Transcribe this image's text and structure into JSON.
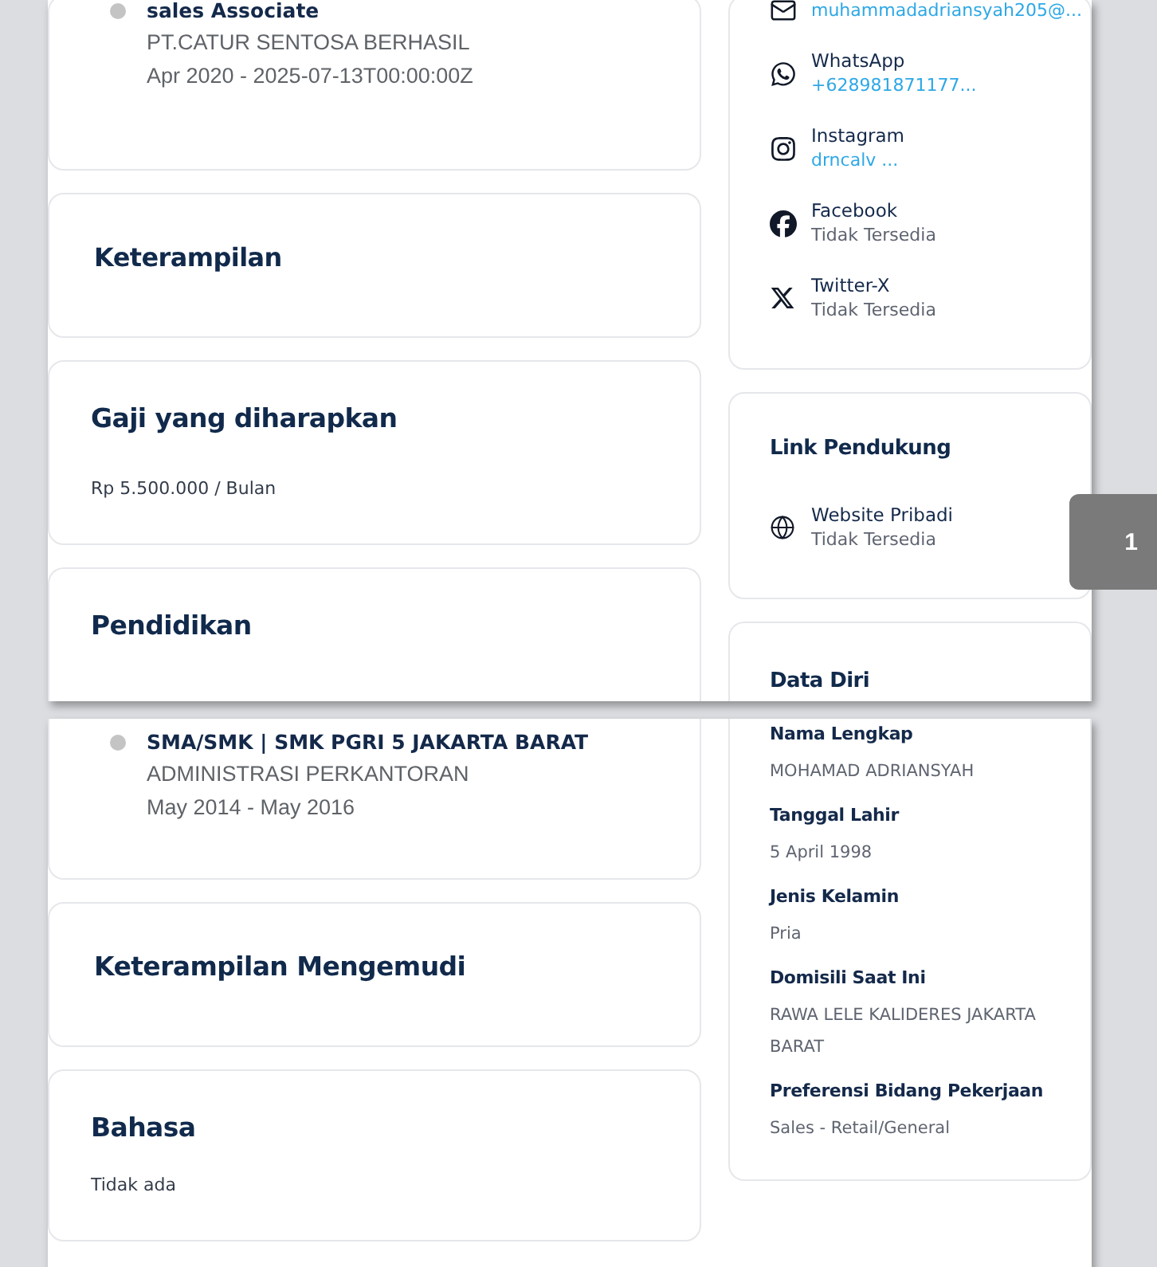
{
  "pages": [
    {
      "left": [
        {
          "kind": "timeline",
          "items": [
            {
              "title": "sales Associate",
              "subtitle": "PT.CATUR SENTOSA BERHASIL",
              "dates": "Apr 2020 - 2025-07-13T00:00:00Z"
            }
          ]
        },
        {
          "kind": "section",
          "title": "Keterampilan"
        },
        {
          "kind": "section",
          "title": "Gaji yang diharapkan",
          "text": "Rp 5.500.000 / Bulan"
        },
        {
          "kind": "section",
          "title": "Pendidikan"
        }
      ],
      "right": [
        {
          "kind": "contacts",
          "items": [
            {
              "kind": "email",
              "value": "muhammadadriansyah205@...",
              "available": true
            },
            {
              "kind": "whatsapp",
              "label": "WhatsApp",
              "value": "+628981871177...",
              "available": true
            },
            {
              "kind": "instagram",
              "label": "Instagram",
              "value": "drncalv ...",
              "available": true
            },
            {
              "kind": "facebook",
              "label": "Facebook",
              "value": "Tidak Tersedia",
              "available": false
            },
            {
              "kind": "twitter",
              "label": "Twitter-X",
              "value": "Tidak Tersedia",
              "available": false
            }
          ]
        },
        {
          "kind": "contacts",
          "title": "Link Pendukung",
          "items": [
            {
              "kind": "website",
              "label": "Website Pribadi",
              "value": "Tidak Tersedia",
              "available": false
            }
          ]
        },
        {
          "kind": "fields",
          "title": "Data Diri"
        }
      ]
    },
    {
      "left": [
        {
          "kind": "timeline",
          "items": [
            {
              "title": "SMA/SMK | SMK PGRI 5 JAKARTA BARAT",
              "subtitle": "ADMINISTRASI PERKANTORAN",
              "dates": "May 2014 - May 2016"
            }
          ]
        },
        {
          "kind": "section",
          "title": "Keterampilan Mengemudi"
        },
        {
          "kind": "section",
          "title": "Bahasa",
          "text": "Tidak ada"
        }
      ],
      "right": [
        {
          "kind": "fields",
          "fields": [
            {
              "label": "Nama Lengkap",
              "value": "MOHAMAD ADRIANSYAH"
            },
            {
              "label": "Tanggal Lahir",
              "value": "5 April 1998"
            },
            {
              "label": "Jenis Kelamin",
              "value": "Pria"
            },
            {
              "label": "Domisili Saat Ini",
              "value": "RAWA LELE KALIDERES JAKARTA BARAT"
            },
            {
              "label": "Preferensi Bidang Pekerjaan",
              "value": "Sales - Retail/General"
            }
          ]
        }
      ]
    }
  ],
  "page_badge": "1"
}
